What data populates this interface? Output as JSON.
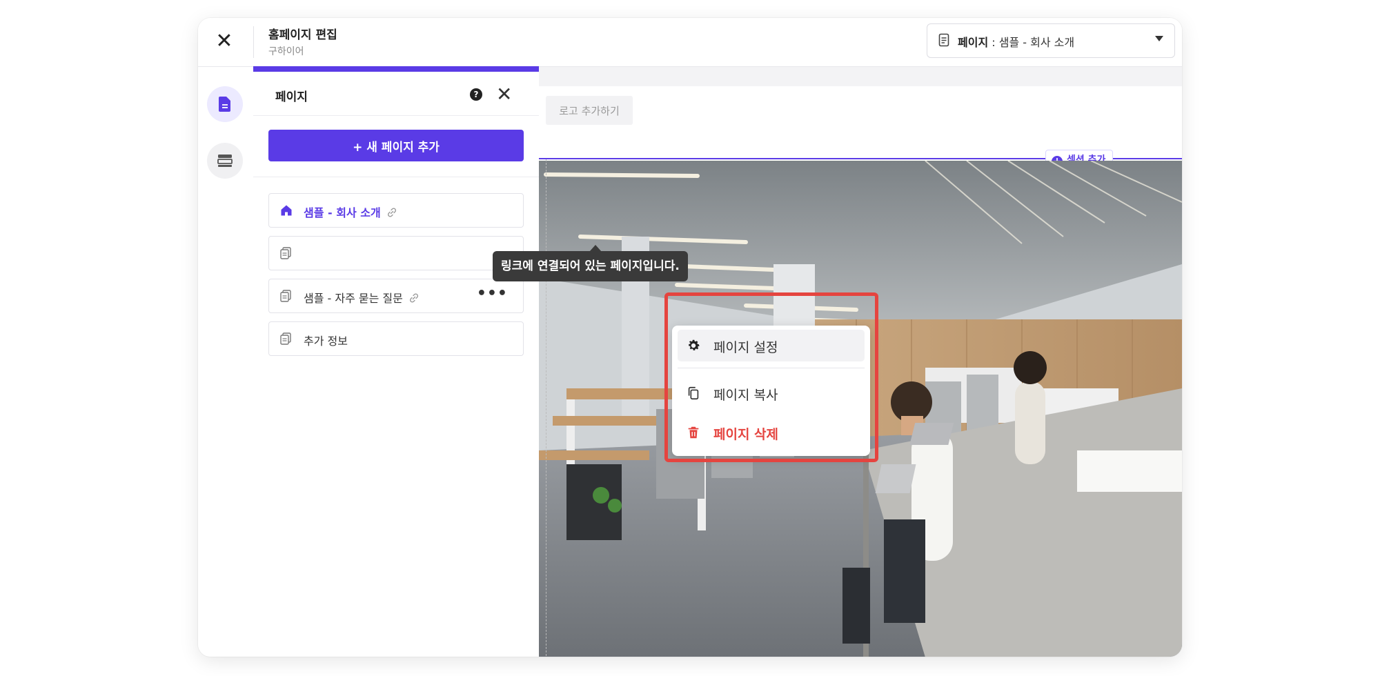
{
  "header": {
    "title": "홈페이지 편집",
    "subtitle": "구하이어",
    "page_select_prefix": "페이지",
    "page_select_value": " : 샘플 - 회사 소개"
  },
  "panel": {
    "title": "페이지",
    "help_label": "?",
    "add_button": "+ 새 페이지 추가",
    "tooltip": "링크에 연결되어 있는 페이지입니다.",
    "items": [
      {
        "label": "샘플 - 회사 소개",
        "icon": "home-icon",
        "linked": true,
        "active": true
      },
      {
        "label": "",
        "icon": "page-icon",
        "linked": false,
        "active": false
      },
      {
        "label": "샘플 - 자주 묻는 질문",
        "icon": "page-icon",
        "linked": true,
        "active": false
      },
      {
        "label": "추가 정보",
        "icon": "page-icon",
        "linked": false,
        "active": false
      }
    ],
    "more_label": "•••"
  },
  "canvas": {
    "logo_button": "로고 추가하기",
    "add_section": "섹션 추가"
  },
  "context_menu": {
    "items": [
      {
        "label": "페이지 설정",
        "icon": "gear-icon"
      },
      {
        "label": "페이지 복사",
        "icon": "copy-icon"
      },
      {
        "label": "페이지 삭제",
        "icon": "trash-icon",
        "danger": true
      }
    ]
  },
  "colors": {
    "accent": "#5a3be6",
    "danger": "#e5443f",
    "tooltip_bg": "#3a3a3a"
  }
}
